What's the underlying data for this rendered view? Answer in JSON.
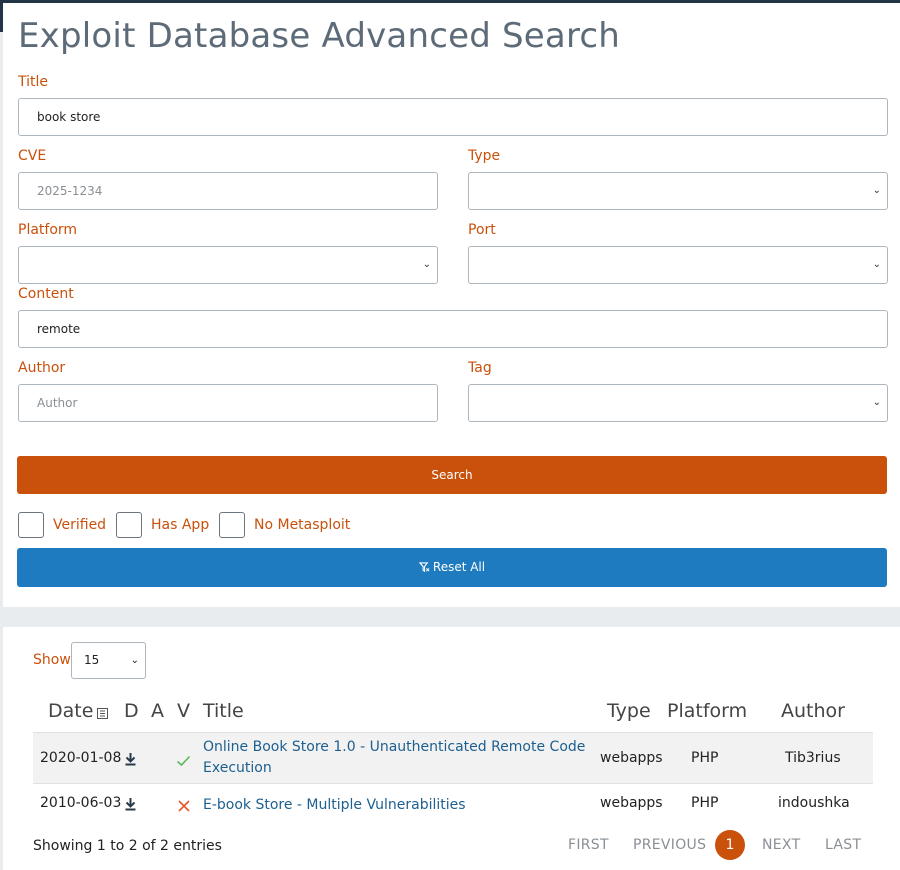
{
  "page_title": "Exploit Database Advanced Search",
  "form": {
    "title_label": "Title",
    "title_value": "book store",
    "cve_label": "CVE",
    "cve_placeholder": "2025-1234",
    "type_label": "Type",
    "type_value": "",
    "platform_label": "Platform",
    "platform_value": "",
    "port_label": "Port",
    "port_value": "",
    "content_label": "Content",
    "content_value": "remote",
    "author_label": "Author",
    "author_placeholder": "Author",
    "tag_label": "Tag",
    "tag_value": ""
  },
  "search_button": "Search",
  "filters": {
    "verified": {
      "label": "Verified",
      "checked": false
    },
    "has_app": {
      "label": "Has App",
      "checked": false
    },
    "no_metasploit": {
      "label": "No Metasploit",
      "checked": false
    }
  },
  "reset_button": "Reset All",
  "results": {
    "show_label": "Show",
    "show_value": "15",
    "columns": {
      "date": "Date",
      "d": "D",
      "a": "A",
      "v": "V",
      "title": "Title",
      "type": "Type",
      "platform": "Platform",
      "author": "Author"
    },
    "rows": [
      {
        "date": "2020-01-08",
        "verified": true,
        "title_line1": "Online Book Store 1.0 - Unauthenticated Remote Code",
        "title_line2": "Execution",
        "type": "webapps",
        "platform": "PHP",
        "author": "Tib3rius"
      },
      {
        "date": "2010-06-03",
        "verified": false,
        "title_line1": "E-book Store - Multiple Vulnerabilities",
        "type": "webapps",
        "platform": "PHP",
        "author": "indoushka"
      }
    ],
    "info": "Showing 1 to 2 of 2 entries",
    "pagination": {
      "first": "FIRST",
      "previous": "PREVIOUS",
      "current": "1",
      "next": "NEXT",
      "last": "LAST"
    }
  },
  "colors": {
    "accent_orange": "#c9510c",
    "reset_blue": "#1e7bbf",
    "link_blue": "#1d5f8f",
    "verified_green": "#5cb85c",
    "unverified_red": "#e8572a"
  }
}
